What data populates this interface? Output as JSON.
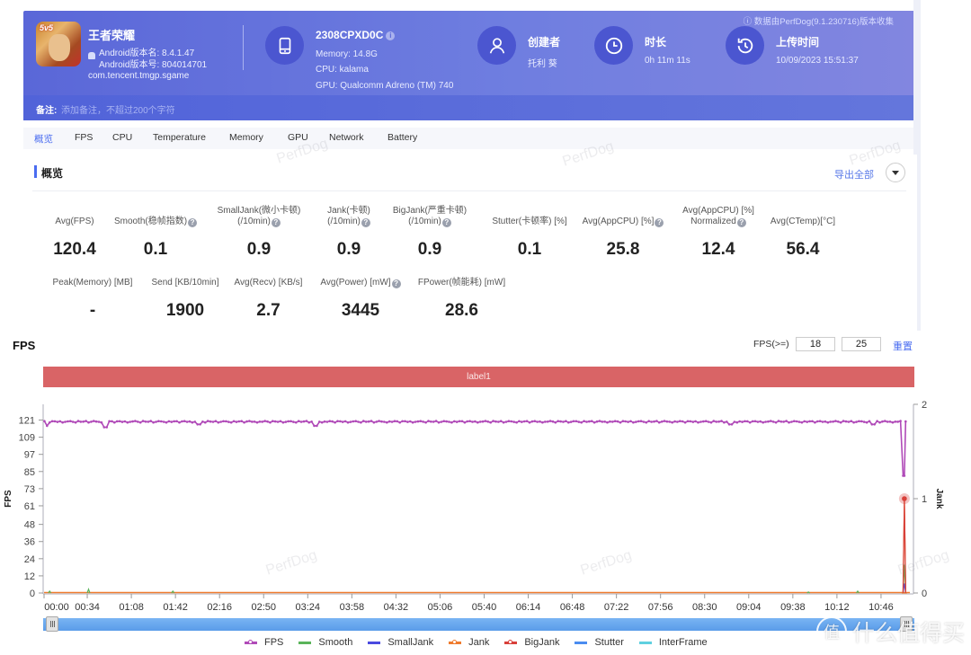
{
  "header": {
    "app": {
      "name": "王者荣耀",
      "icon": "game-icon",
      "icon_badge": "5v5",
      "version_name": "Android版本名: 8.4.1.47",
      "version_code": "Android版本号: 804014701",
      "package": "com.tencent.tmgp.sgame"
    },
    "device": {
      "model": "2308CPXD0C",
      "memory": "Memory: 14.8G",
      "cpu": "CPU: kalama",
      "gpu": "GPU: Qualcomm Adreno (TM) 740",
      "icon": "phone-icon"
    },
    "creator": {
      "title": "创建者",
      "value": "托利 葵",
      "icon": "user-icon"
    },
    "duration": {
      "title": "时长",
      "value": "0h 11m 11s",
      "icon": "clock-icon"
    },
    "upload": {
      "title": "上传时间",
      "value": "10/09/2023 15:51:37",
      "icon": "history-icon"
    },
    "collected_by": "ⓘ 数据由PerfDog(9.1.230716)版本收集",
    "note_label": "备注:",
    "note_placeholder": "添加备注，不超过200个字符"
  },
  "tabs": [
    {
      "label": "概览",
      "active": true
    },
    {
      "label": "FPS"
    },
    {
      "label": "CPU"
    },
    {
      "label": "Temperature"
    },
    {
      "label": "Memory"
    },
    {
      "label": "GPU"
    },
    {
      "label": "Network"
    },
    {
      "label": "Battery"
    }
  ],
  "overview": {
    "title": "概览",
    "export_label": "导出全部",
    "metrics_row1": [
      {
        "label1": "",
        "label2": "Avg(FPS)",
        "help": false,
        "value": "120.4"
      },
      {
        "label1": "",
        "label2": "Smooth(稳帧指数)",
        "help": true,
        "value": "0.1"
      },
      {
        "label1": "SmallJank(微小卡顿)",
        "label2": "(/10min)",
        "help": true,
        "value": "0.9"
      },
      {
        "label1": "Jank(卡顿)",
        "label2": "(/10min)",
        "help": true,
        "value": "0.9"
      },
      {
        "label1": "BigJank(严重卡顿)",
        "label2": "(/10min)",
        "help": true,
        "value": "0.9"
      },
      {
        "label1": "",
        "label2": "Stutter(卡顿率) [%]",
        "help": false,
        "value": "0.1"
      },
      {
        "label1": "",
        "label2": "Avg(AppCPU) [%]",
        "help": true,
        "value": "25.8"
      },
      {
        "label1": "Avg(AppCPU) [%]",
        "label2": "Normalized",
        "help": true,
        "value": "12.4"
      },
      {
        "label1": "",
        "label2": "Avg(CTemp)[°C]",
        "help": false,
        "value": "56.4"
      }
    ],
    "metrics_row2": [
      {
        "label": "Peak(Memory) [MB]",
        "help": false,
        "value": "-"
      },
      {
        "label": "Send [KB/10min]",
        "help": false,
        "value": "1900"
      },
      {
        "label": "Avg(Recv) [KB/s]",
        "help": false,
        "value": "2.7"
      },
      {
        "label": "Avg(Power) [mW]",
        "help": true,
        "value": "3445"
      },
      {
        "label": "FPower(帧能耗) [mW]",
        "help": false,
        "value": "28.6"
      }
    ]
  },
  "fps_section": {
    "title": "FPS",
    "filter_label": "FPS(>=)",
    "filter_low": "18",
    "filter_high": "25",
    "reset_label": "重置",
    "band_label": "label1"
  },
  "watermark_text": "PerfDog",
  "site_watermark": {
    "icon_text": "值",
    "text": "什么值得买"
  },
  "chart_data": {
    "type": "line",
    "title": "FPS",
    "xlabel": "",
    "ylabel": "FPS",
    "y2label": "Jank",
    "x_ticks": [
      "00:00",
      "00:34",
      "01:08",
      "01:42",
      "02:16",
      "02:50",
      "03:24",
      "03:58",
      "04:32",
      "05:06",
      "05:40",
      "06:14",
      "06:48",
      "07:22",
      "07:56",
      "08:30",
      "09:04",
      "09:38",
      "10:12",
      "10:46"
    ],
    "x_range_seconds": [
      0,
      671
    ],
    "y_ticks": [
      0,
      12,
      24,
      36,
      48,
      61,
      73,
      85,
      97,
      109,
      121
    ],
    "ylim": [
      0,
      132
    ],
    "y2_ticks": [
      0,
      1,
      2
    ],
    "y2lim": [
      0,
      2
    ],
    "grid": false,
    "legend_position": "bottom",
    "series": [
      {
        "name": "FPS",
        "color": "#b04ab8",
        "axis": "left",
        "marker": true,
        "description": "steady around 120 for whole session with occasional dips to ~117; sharp drop to ~82 at ~11:08",
        "baseline": 120,
        "dips": [
          [
            3,
            117
          ],
          [
            48,
            116
          ],
          [
            120,
            118
          ],
          [
            210,
            117
          ],
          [
            530,
            118
          ],
          [
            640,
            118
          ],
          [
            664,
            82
          ],
          [
            666,
            120
          ]
        ]
      },
      {
        "name": "Smooth",
        "color": "#5ab45a",
        "axis": "right",
        "marker": false,
        "points": [
          [
            5,
            0.02
          ],
          [
            35,
            0.04
          ],
          [
            100,
            0.02
          ],
          [
            590,
            0.01
          ],
          [
            628,
            0.02
          ],
          [
            664,
            0.3
          ]
        ]
      },
      {
        "name": "SmallJank",
        "color": "#4a4ae0",
        "axis": "right",
        "marker": false,
        "points": [
          [
            664,
            0.1
          ]
        ]
      },
      {
        "name": "Jank",
        "color": "#ef7b2e",
        "axis": "right",
        "marker": true,
        "points": [
          [
            663,
            0
          ],
          [
            664,
            1
          ],
          [
            665,
            0
          ]
        ]
      },
      {
        "name": "BigJank",
        "color": "#d8403a",
        "axis": "right",
        "marker": true,
        "points": [
          [
            664,
            1
          ]
        ]
      },
      {
        "name": "Stutter",
        "color": "#4a8cf0",
        "axis": "right",
        "marker": false,
        "points": []
      },
      {
        "name": "InterFrame",
        "color": "#5fd0e0",
        "axis": "right",
        "marker": false,
        "points": []
      }
    ]
  }
}
